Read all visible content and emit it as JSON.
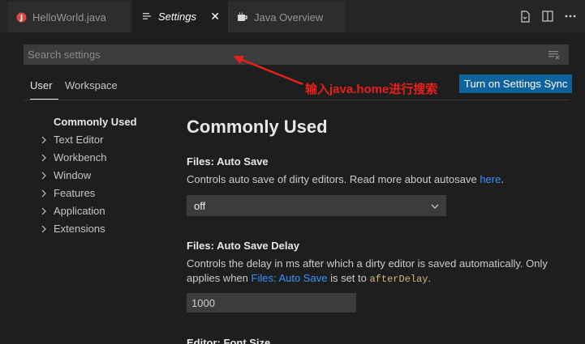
{
  "tabs": [
    {
      "label": "HelloWorld.java",
      "icon": "java-error-icon",
      "active": false
    },
    {
      "label": "Settings",
      "icon": "settings-lines-icon",
      "active": true
    },
    {
      "label": "Java Overview",
      "icon": "java-cup-icon",
      "active": false
    }
  ],
  "editor_actions": [
    "open-settings-json-icon",
    "split-editor-icon",
    "more-actions-icon"
  ],
  "search": {
    "placeholder": "Search settings",
    "value": ""
  },
  "scope_tabs": {
    "user": "User",
    "workspace": "Workspace"
  },
  "sync_button": "Turn on Settings Sync",
  "annotation": "输入java.home进行搜索",
  "toc": {
    "active": "Commonly Used",
    "items": [
      "Text Editor",
      "Workbench",
      "Window",
      "Features",
      "Application",
      "Extensions"
    ]
  },
  "section_title": "Commonly Used",
  "settings": {
    "auto_save": {
      "category": "Files: ",
      "name": "Auto Save",
      "desc": "Controls auto save of dirty editors. Read more about autosave ",
      "link": "here",
      "desc_end": ".",
      "value": "off"
    },
    "auto_save_delay": {
      "category": "Files: ",
      "name": "Auto Save Delay",
      "desc": "Controls the delay in ms after which a dirty editor is saved automatically. Only applies when ",
      "link": "Files: Auto Save",
      "desc_mid": " is set to ",
      "code": "afterDelay",
      "desc_end": ".",
      "value": "1000"
    },
    "font_size": {
      "category": "Editor: ",
      "name": "Font Size"
    }
  },
  "colors": {
    "accent": "#0e639c",
    "link": "#3794ff",
    "annotation": "#e8201c",
    "background": "#1e1e1e"
  }
}
